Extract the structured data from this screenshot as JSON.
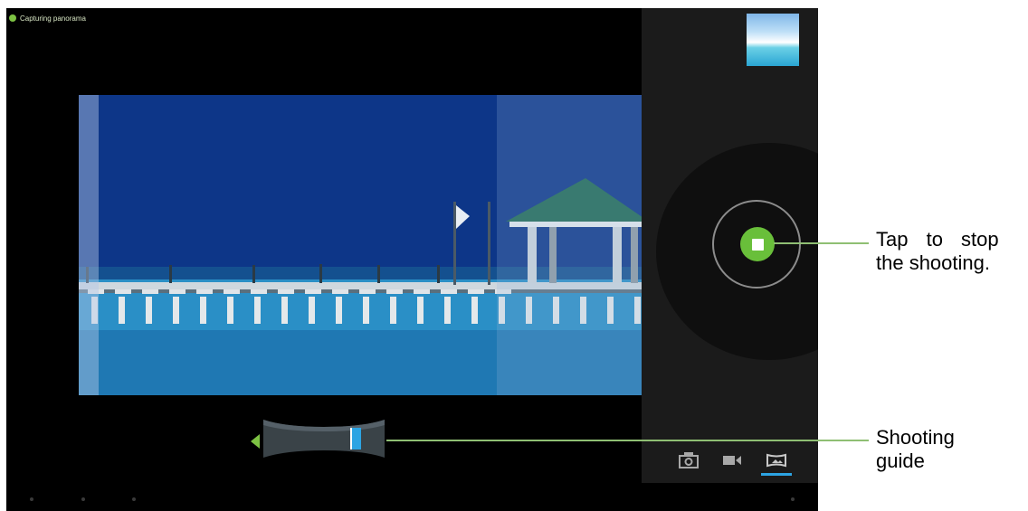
{
  "status_bar": {
    "text": "Capturing panorama",
    "indicator_color": "#7dc243"
  },
  "viewfinder": {
    "description_colors": {
      "sky": "#0e3a8a",
      "sea": "#2a8fc6"
    }
  },
  "controls": {
    "stop_button_icon": "stop-icon",
    "accent": "#69bf3a",
    "modes": [
      {
        "icon": "camera-icon",
        "selected": false
      },
      {
        "icon": "video-icon",
        "selected": false
      },
      {
        "icon": "panorama-icon",
        "selected": true
      }
    ]
  },
  "shooting_guide": {
    "arrow_icon": "left-arrow-icon",
    "progress_color": "#2da4e3"
  },
  "annotations": {
    "stop_line1": "Tap to stop",
    "stop_line2": "the shooting.",
    "guide_line1": "Shooting",
    "guide_line2": "guide"
  }
}
